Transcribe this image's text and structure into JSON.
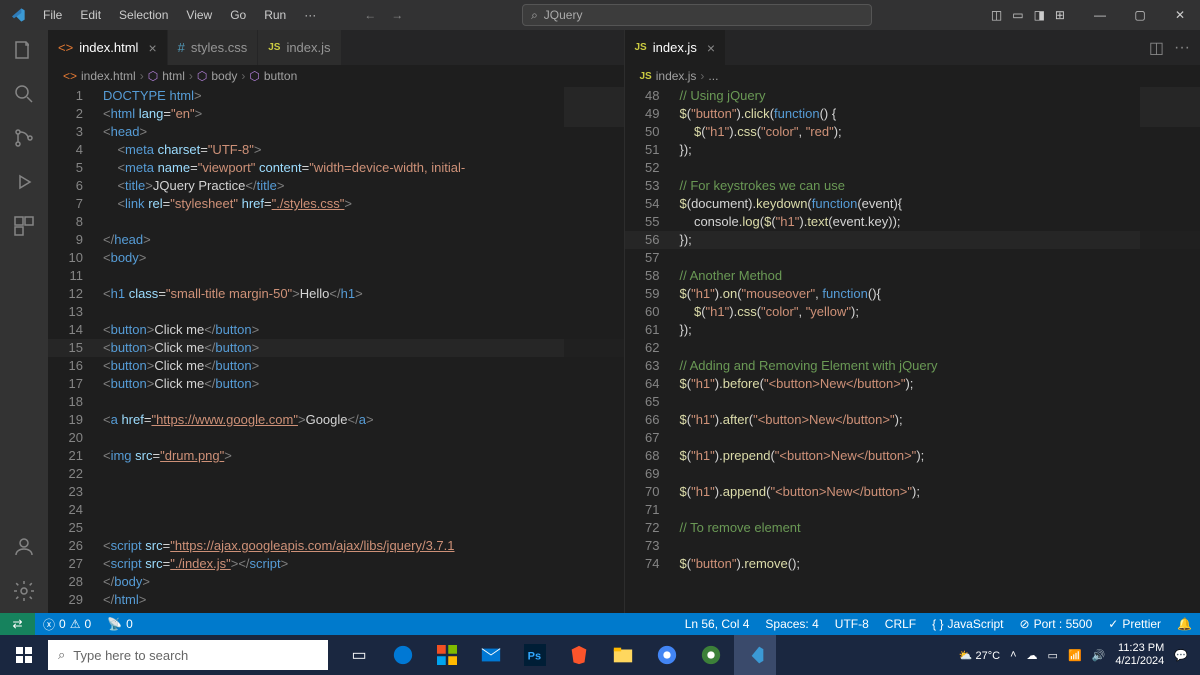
{
  "menu": {
    "file": "File",
    "edit": "Edit",
    "selection": "Selection",
    "view": "View",
    "go": "Go",
    "run": "Run",
    "more": "···"
  },
  "search": {
    "text": "JQuery"
  },
  "tabs_left": {
    "index_html": "index.html",
    "styles_css": "styles.css",
    "index_js": "index.js"
  },
  "tabs_right": {
    "index_js": "index.js"
  },
  "breadcrumb_left": {
    "file": "index.html",
    "p1": "html",
    "p2": "body",
    "p3": "button"
  },
  "breadcrumb_right": {
    "file": "index.js",
    "rest": "..."
  },
  "code_left": {
    "lines": [
      "1",
      "2",
      "3",
      "4",
      "5",
      "6",
      "7",
      "8",
      "9",
      "10",
      "11",
      "12",
      "13",
      "14",
      "15",
      "16",
      "17",
      "18",
      "19",
      "20",
      "21",
      "22",
      "23",
      "24",
      "25",
      "26",
      "27",
      "28",
      "29"
    ]
  },
  "code_right": {
    "lines": [
      "48",
      "49",
      "50",
      "51",
      "52",
      "53",
      "54",
      "55",
      "56",
      "57",
      "58",
      "59",
      "60",
      "61",
      "62",
      "63",
      "64",
      "65",
      "66",
      "67",
      "68",
      "69",
      "70",
      "71",
      "72",
      "73",
      "74"
    ]
  },
  "html": {
    "doctype_l": "<!",
    "doctype_r": ">",
    "doctype_k": "DOCTYPE",
    "doctype_h": "html",
    "html_open": "html",
    "lang_attr": "lang",
    "lang_val": "\"en\"",
    "head": "head",
    "meta": "meta",
    "charset": "charset",
    "charset_v": "\"UTF-8\"",
    "name_attr": "name",
    "viewport_v": "\"viewport\"",
    "content_attr": "content",
    "content_v": "\"width=device-width, initial-",
    "title": "title",
    "title_text": "JQuery Practice",
    "link": "link",
    "rel": "rel",
    "rel_v": "\"stylesheet\"",
    "href": "href",
    "href_css": "\"./styles.css\"",
    "body": "body",
    "h1": "h1",
    "class": "class",
    "h1class": "\"small-title margin-50\"",
    "hello": "Hello",
    "button": "button",
    "click_me": "Click me",
    "a": "a",
    "a_href": "\"https://www.google.com\"",
    "google": "Google",
    "img": "img",
    "src": "src",
    "drum": "\"drum.png\"",
    "script": "script",
    "jquery_src": "\"https://ajax.googleapis.com/ajax/libs/jquery/3.7.1",
    "index_src": "\"./index.js\""
  },
  "js": {
    "c1": "// Using jQuery",
    "l49a": "$(",
    "l49b": "\"button\"",
    "l49c": ").",
    "click": "click",
    "l49d": "(",
    "func": "function",
    "l49e": "() {",
    "l50a": "$(",
    "l50b": "\"h1\"",
    "l50c": ").",
    "css": "css",
    "l50d": "(",
    "l50e": "\"color\"",
    "l50f": ", ",
    "l50g": "\"red\"",
    "l50h": ");",
    "l51": "});",
    "c2": "// For keystrokes we can use",
    "l54a": "$(document).",
    "keydown": "keydown",
    "l54b": "(",
    "l54c": "(event){",
    "l55a": "console.",
    "log": "log",
    "l55b": "($(",
    "l55c": "\"h1\"",
    "l55d": ").",
    "text": "text",
    "l55e": "(event.key));",
    "l56": "});",
    "c3": "// Another Method",
    "l59a": "$(",
    "l59b": "\"h1\"",
    "l59c": ").",
    "on": "on",
    "l59d": "(",
    "l59e": "\"mouseover\"",
    "l59f": ", ",
    "l59g": "(){",
    "l60a": "$(",
    "l60b": "\"h1\"",
    "l60c": ").",
    "l60d": "(",
    "l60e": "\"color\"",
    "l60f": ", ",
    "l60g": "\"yellow\"",
    "l60h": ");",
    "l61": "});",
    "c4": "// Adding and Removing Element with jQuery",
    "l64a": "$(",
    "l64b": "\"h1\"",
    "l64c": ").",
    "before": "before",
    "l64d": "(",
    "l64e": "\"<button>New</button>\"",
    "l64f": ");",
    "l66a": "$(",
    "l66b": "\"h1\"",
    "l66c": ").",
    "after": "after",
    "l66d": "(",
    "l66e": "\"<button>New</button>\"",
    "l66f": ");",
    "l68a": "$(",
    "l68b": "\"h1\"",
    "l68c": ").",
    "prepend": "prepend",
    "l68d": "(",
    "l68e": "\"<button>New</button>\"",
    "l68f": ");",
    "l70a": "$(",
    "l70b": "\"h1\"",
    "l70c": ").",
    "append": "append",
    "l70d": "(",
    "l70e": "\"<button>New</button>\"",
    "l70f": ");",
    "c5": "// To remove element",
    "l74a": "$(",
    "l74b": "\"button\"",
    "l74c": ").",
    "remove": "remove",
    "l74d": "();"
  },
  "status": {
    "errors": "0",
    "warnings": "0",
    "port_icon": "0",
    "ln_col": "Ln 56, Col 4",
    "spaces": "Spaces: 4",
    "enc": "UTF-8",
    "eol": "CRLF",
    "lang": "JavaScript",
    "port": "Port : 5500",
    "prettier": "Prettier"
  },
  "taskbar": {
    "search_placeholder": "Type here to search",
    "weather": "27°C",
    "time": "11:23 PM",
    "date": "4/21/2024"
  }
}
